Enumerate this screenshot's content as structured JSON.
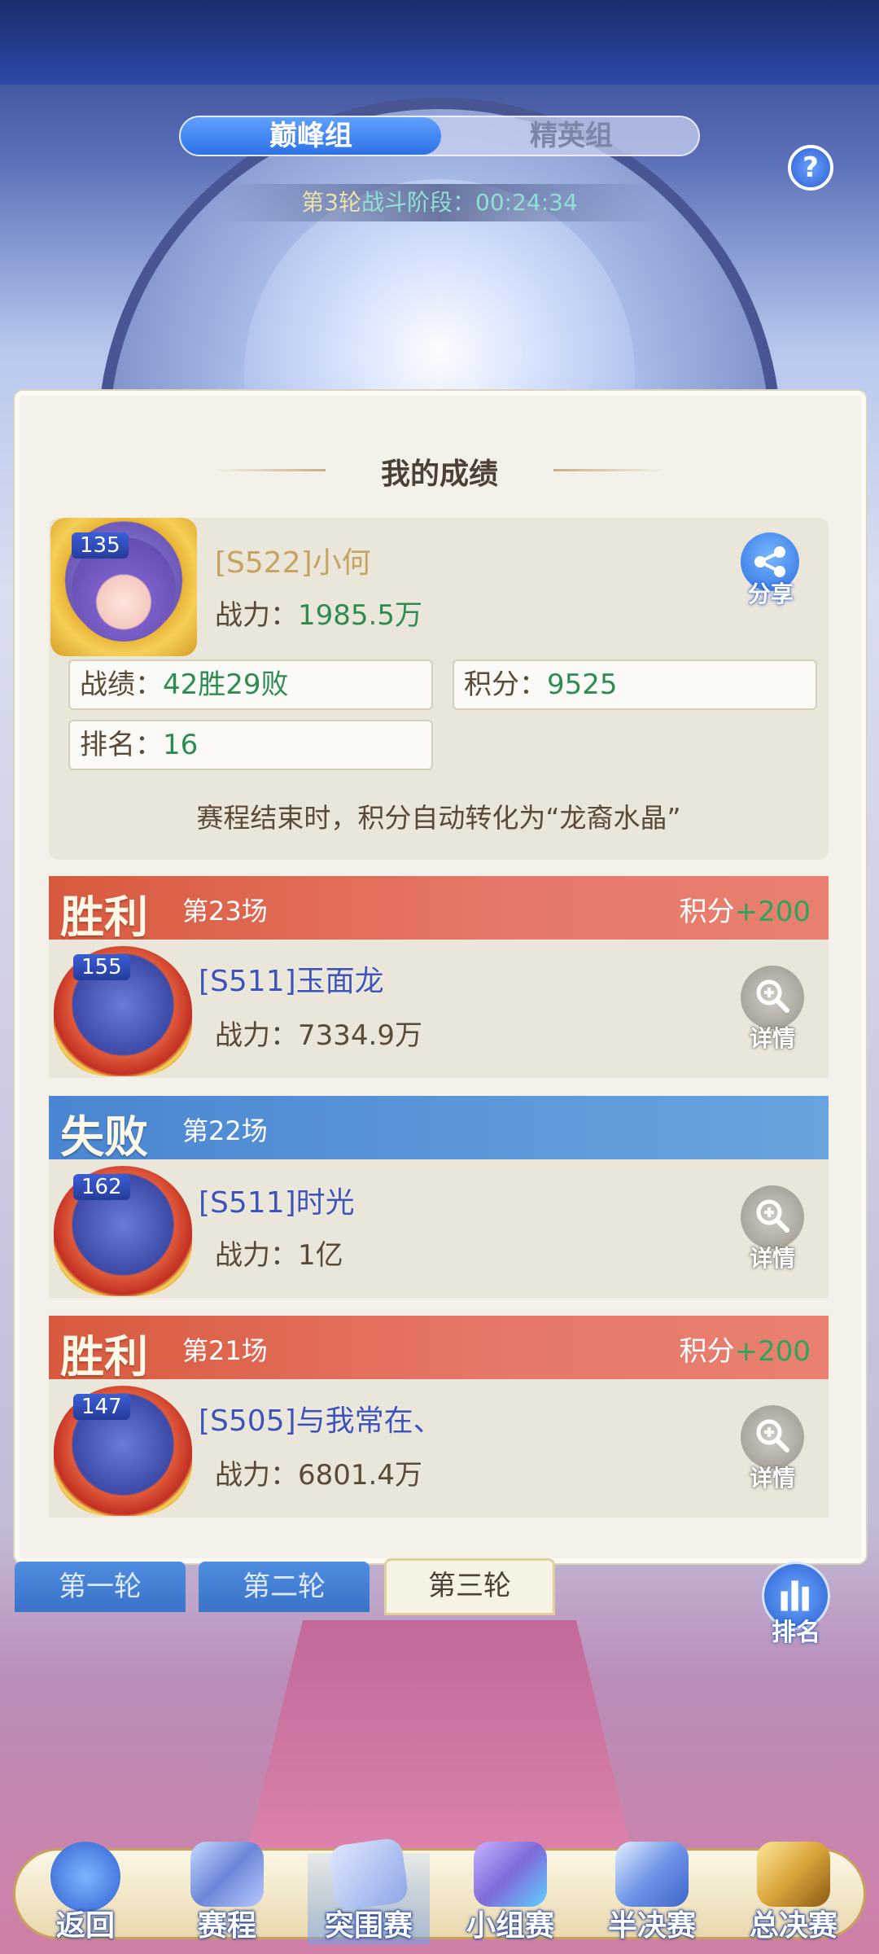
{
  "header": {
    "group_tabs": [
      "巅峰组",
      "精英组"
    ],
    "round_label": "第3轮",
    "phase_label": "战斗阶段：",
    "timer": "00:24:34",
    "help_icon": "question-icon"
  },
  "my_record": {
    "title": "我的成绩",
    "level": "135",
    "name": "[S522]小何",
    "power_label": "战力：",
    "power_value": "1985.5万",
    "share_label": "分享",
    "stats": {
      "record_label": "战绩：",
      "record_value": "42胜29败",
      "points_label": "积分：",
      "points_value": "9525",
      "rank_label": "排名：",
      "rank_value": "16"
    },
    "note": "赛程结束时，积分自动转化为“龙裔水晶”"
  },
  "matches": [
    {
      "result": "胜利",
      "match_no": "第23场",
      "score_label": "积分",
      "score_value": "+200",
      "level": "155",
      "name": "[S511]玉面龙",
      "power_label": "战力：",
      "power_value": "7334.9万",
      "detail_label": "详情"
    },
    {
      "result": "失败",
      "match_no": "第22场",
      "level": "162",
      "name": "[S511]时光",
      "power_label": "战力：",
      "power_value": "1亿",
      "detail_label": "详情"
    },
    {
      "result": "胜利",
      "match_no": "第21场",
      "score_label": "积分",
      "score_value": "+200",
      "level": "147",
      "name": "[S505]与我常在、",
      "power_label": "战力：",
      "power_value": "6801.4万",
      "detail_label": "详情"
    }
  ],
  "round_tabs": [
    "第一轮",
    "第二轮",
    "第三轮"
  ],
  "rank_label": "排名",
  "bottom_nav": [
    "返回",
    "赛程",
    "突围赛",
    "小组赛",
    "半决赛",
    "总决赛"
  ],
  "colors": {
    "win": "#d85a3e",
    "lose": "#4a86d1",
    "accent_green": "#2c8c52"
  }
}
